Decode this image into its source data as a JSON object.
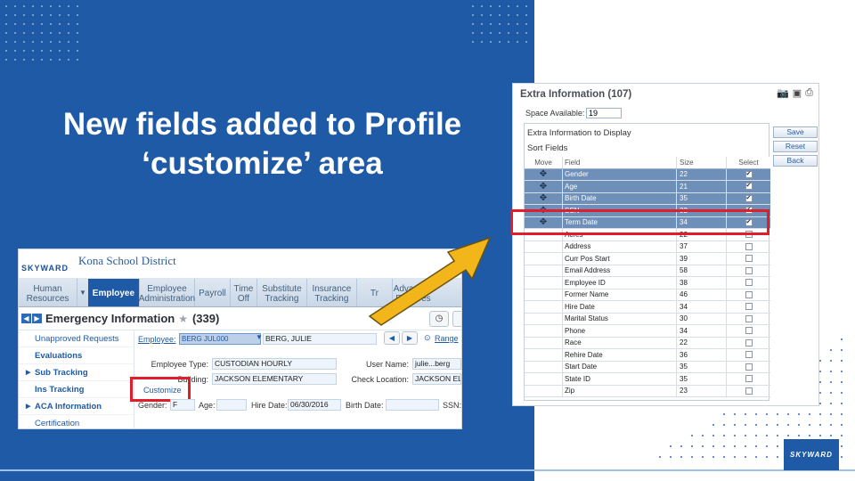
{
  "slide": {
    "title_line1": "New fields added to Profile",
    "title_line2": "‘customize’ area",
    "colors": {
      "blue": "#1f5aa6",
      "highlight": "#e01d2b",
      "arrow": "#f2b51a"
    }
  },
  "left_screenshot": {
    "logo_text": "SKYWARD",
    "district": "Kona School District",
    "nav": [
      "Human Resources",
      "Employee",
      "Employee Administration",
      "Payroll",
      "Time Off",
      "Substitute Tracking",
      "Insurance Tracking",
      "Tr",
      "Advanced Features"
    ],
    "page_title": "Emergency Information",
    "count": "(339)",
    "sidebar": [
      "Unapproved Requests",
      "Evaluations",
      "Sub Tracking",
      "Ins Tracking",
      "ACA Information",
      "Certification"
    ],
    "employee_label": "Employee:",
    "employee_select": "BERG JUL000",
    "employee_name": "BERG, JULIE",
    "range_link": "Range",
    "employee_type_label": "Employee Type:",
    "employee_type": "CUSTODIAN HOURLY",
    "user_name_label": "User Name:",
    "user_name": "julie...berg",
    "building_label": "Building:",
    "building": "JACKSON ELEMENTARY",
    "check_location_label": "Check Location:",
    "check_location": "JACKSON EL",
    "customize_link": "Customize",
    "gender_label": "Gender:",
    "gender": "F",
    "age_label": "Age:",
    "hire_date_label": "Hire Date:",
    "hire_date": "06/30/2016",
    "birth_date_label": "Birth Date:",
    "ssn_label": "SSN:"
  },
  "right_screenshot": {
    "title": "Extra Information (107)",
    "space_label": "Space Available:",
    "space_value": "19",
    "inner_title": "Extra Information to Display",
    "sort_fields": "Sort Fields",
    "columns": [
      "Move",
      "Field",
      "Size",
      "Select"
    ],
    "buttons": [
      "Save",
      "Reset",
      "Back"
    ],
    "rows": [
      {
        "field": "Gender",
        "size": "22",
        "checked": true
      },
      {
        "field": "Age",
        "size": "21",
        "checked": true
      },
      {
        "field": "Birth Date",
        "size": "35",
        "checked": true
      },
      {
        "field": "SSN",
        "size": "32",
        "checked": true
      },
      {
        "field": "Term Date",
        "size": "34",
        "checked": true
      },
      {
        "field": "Acres",
        "size": "22",
        "checked": false
      },
      {
        "field": "Address",
        "size": "37",
        "checked": false
      },
      {
        "field": "Curr Pos Start",
        "size": "39",
        "checked": false
      },
      {
        "field": "Email Address",
        "size": "58",
        "checked": false
      },
      {
        "field": "Employee ID",
        "size": "38",
        "checked": false
      },
      {
        "field": "Former Name",
        "size": "46",
        "checked": false
      },
      {
        "field": "Hire Date",
        "size": "34",
        "checked": false
      },
      {
        "field": "Marital Status",
        "size": "30",
        "checked": false
      },
      {
        "field": "Phone",
        "size": "34",
        "checked": false
      },
      {
        "field": "Race",
        "size": "22",
        "checked": false
      },
      {
        "field": "Rehire Date",
        "size": "36",
        "checked": false
      },
      {
        "field": "Start Date",
        "size": "35",
        "checked": false
      },
      {
        "field": "State ID",
        "size": "35",
        "checked": false
      },
      {
        "field": "Zip",
        "size": "23",
        "checked": false
      }
    ]
  },
  "corner_logo": "SKYWARD"
}
